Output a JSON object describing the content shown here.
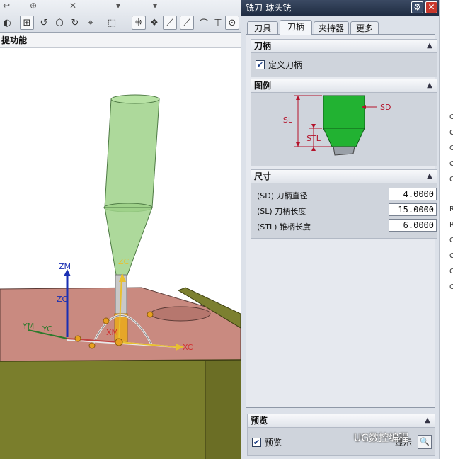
{
  "toolbar": {
    "func_label": "捉功能"
  },
  "dialog": {
    "title": "铣刀-球头铣",
    "tabs": [
      {
        "label": "刀具"
      },
      {
        "label": "刀柄"
      },
      {
        "label": "夹持器"
      },
      {
        "label": "更多"
      }
    ],
    "active_tab": "刀柄",
    "shank_section": {
      "header": "刀柄",
      "checkbox_label": "定义刀柄",
      "checked": true
    },
    "legend_section": {
      "header": "图例",
      "labels": {
        "sd": "SD",
        "sl": "SL",
        "stl": "STL"
      }
    },
    "dimensions_section": {
      "header": "尺寸",
      "rows": [
        {
          "label": "(SD) 刀柄直径",
          "value": "4.0000"
        },
        {
          "label": "(SL) 刀柄长度",
          "value": "15.0000"
        },
        {
          "label": "(STL) 锥柄长度",
          "value": "6.0000"
        }
      ]
    },
    "preview_section": {
      "header": "预览",
      "checkbox_label": "预览",
      "checked": true,
      "show_button_label": "显示"
    }
  },
  "viewport": {
    "axis_labels": {
      "zm": "ZM",
      "zc_left": "ZC",
      "zc_top": "ZC",
      "ym": "YM",
      "yc": "YC",
      "xc": "XC",
      "xm": "XM"
    }
  },
  "right_strip": [
    "C",
    "C",
    "C",
    "C",
    "C",
    "R",
    "R",
    "C",
    "C",
    "C",
    "C"
  ],
  "watermark": "UG数控编程",
  "colors": {
    "legend_fill": "#22b232",
    "dimension_line": "#b4122a",
    "tool_green": "#9fd28a",
    "part_top": "#c98a80",
    "part_side": "#7a7e2c"
  }
}
